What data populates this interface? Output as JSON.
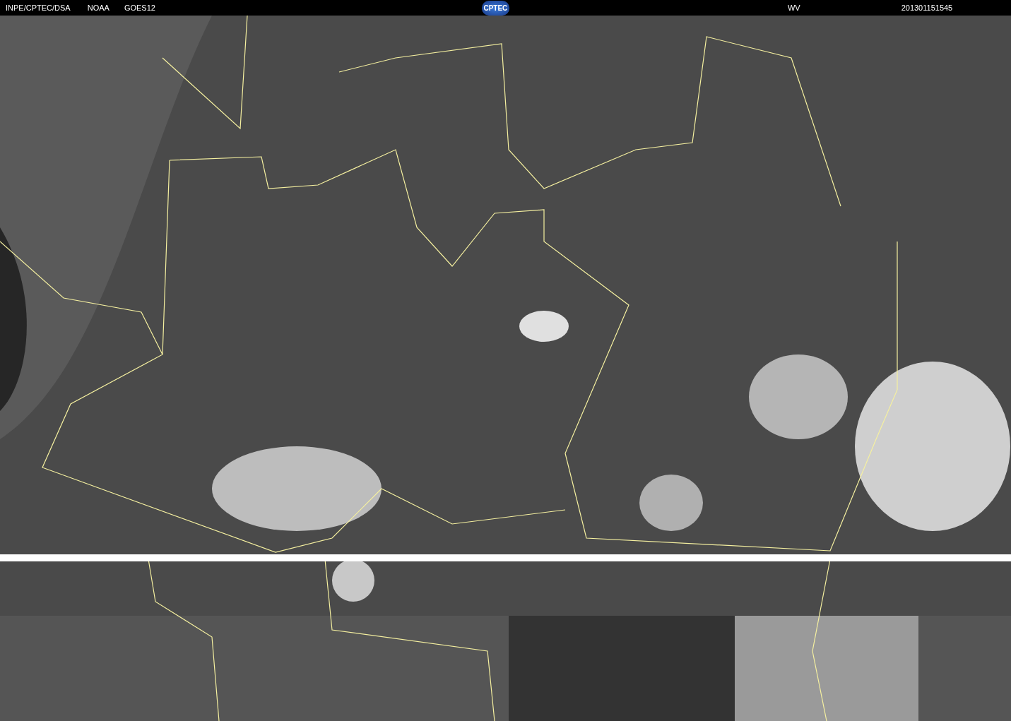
{
  "header": {
    "source": "INPE/CPTEC/DSA",
    "agency": "NOAA",
    "satellite": "GOES12",
    "logo": "CPTEC",
    "channel": "WV",
    "timestamp": "201301151545"
  }
}
